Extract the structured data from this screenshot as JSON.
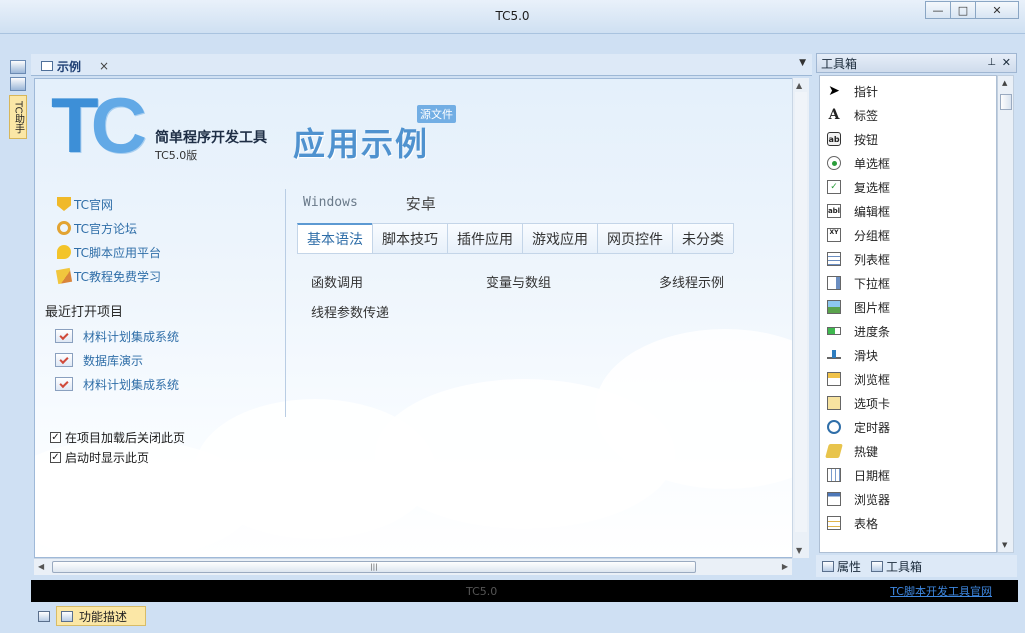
{
  "window": {
    "title": "TC5.0",
    "minimize": "—",
    "maximize": "□",
    "close": "✕"
  },
  "left_strip": {
    "tab_label": "TC助手"
  },
  "document": {
    "tab_title": "示例",
    "tab_close": "×",
    "dropdown": "▼"
  },
  "header": {
    "logo_t": "T",
    "logo_c": "C",
    "subtitle": "简单程序开发工具",
    "version": "TC5.0版",
    "app_title": "应用示例",
    "badge": "源文件"
  },
  "links": [
    {
      "label": "TC官网",
      "icon": "shield-icon"
    },
    {
      "label": "TC官方论坛",
      "icon": "search-icon"
    },
    {
      "label": "TC脚本应用平台",
      "icon": "chat-icon"
    },
    {
      "label": "TC教程免费学习",
      "icon": "pencil-icon"
    }
  ],
  "recent": {
    "title": "最近打开项目",
    "items": [
      "材料计划集成系统",
      "数据库演示",
      "材料计划集成系统"
    ]
  },
  "checks": [
    {
      "label": "在项目加载后关闭此页",
      "checked": "✓"
    },
    {
      "label": "启动时显示此页",
      "checked": "✓"
    }
  ],
  "top_tabs": [
    "Windows",
    "安卓"
  ],
  "category_tabs": [
    "基本语法",
    "脚本技巧",
    "插件应用",
    "游戏应用",
    "网页控件",
    "未分类"
  ],
  "examples": {
    "row1": [
      "函数调用",
      "变量与数组",
      "多线程示例"
    ],
    "row2": [
      "线程参数传递"
    ]
  },
  "toolbox": {
    "title": "工具箱",
    "pin": "⊥",
    "close": "✕",
    "items": [
      {
        "label": "指针",
        "icon": "pointer-icon",
        "glyph": "➤"
      },
      {
        "label": "标签",
        "icon": "label-icon",
        "glyph": "A"
      },
      {
        "label": "按钮",
        "icon": "button-icon",
        "glyph": "ab"
      },
      {
        "label": "单选框",
        "icon": "radio-icon",
        "glyph": ""
      },
      {
        "label": "复选框",
        "icon": "checkbox-icon",
        "glyph": "✓"
      },
      {
        "label": "编辑框",
        "icon": "edit-icon",
        "glyph": "abl"
      },
      {
        "label": "分组框",
        "icon": "groupbox-icon",
        "glyph": "XY"
      },
      {
        "label": "列表框",
        "icon": "listbox-icon",
        "glyph": ""
      },
      {
        "label": "下拉框",
        "icon": "combobox-icon",
        "glyph": ""
      },
      {
        "label": "图片框",
        "icon": "image-icon",
        "glyph": ""
      },
      {
        "label": "进度条",
        "icon": "progress-icon",
        "glyph": ""
      },
      {
        "label": "滑块",
        "icon": "slider-icon",
        "glyph": ""
      },
      {
        "label": "浏览框",
        "icon": "browse-icon",
        "glyph": ""
      },
      {
        "label": "选项卡",
        "icon": "tab-control-icon",
        "glyph": ""
      },
      {
        "label": "定时器",
        "icon": "timer-icon",
        "glyph": ""
      },
      {
        "label": "热键",
        "icon": "hotkey-icon",
        "glyph": ""
      },
      {
        "label": "日期框",
        "icon": "date-icon",
        "glyph": ""
      },
      {
        "label": "浏览器",
        "icon": "browser-icon",
        "glyph": ""
      },
      {
        "label": "表格",
        "icon": "grid-icon",
        "glyph": ""
      }
    ],
    "bottom_tabs": [
      "属性",
      "工具箱"
    ]
  },
  "status": {
    "center": "TC5.0",
    "link": "TC脚本开发工具官网"
  },
  "bottom_tab": "功能描述",
  "colors": {
    "accent_blue": "#3d8fd7",
    "link_blue": "#2f6ea8",
    "tab_yellow": "#fbe7a6"
  }
}
